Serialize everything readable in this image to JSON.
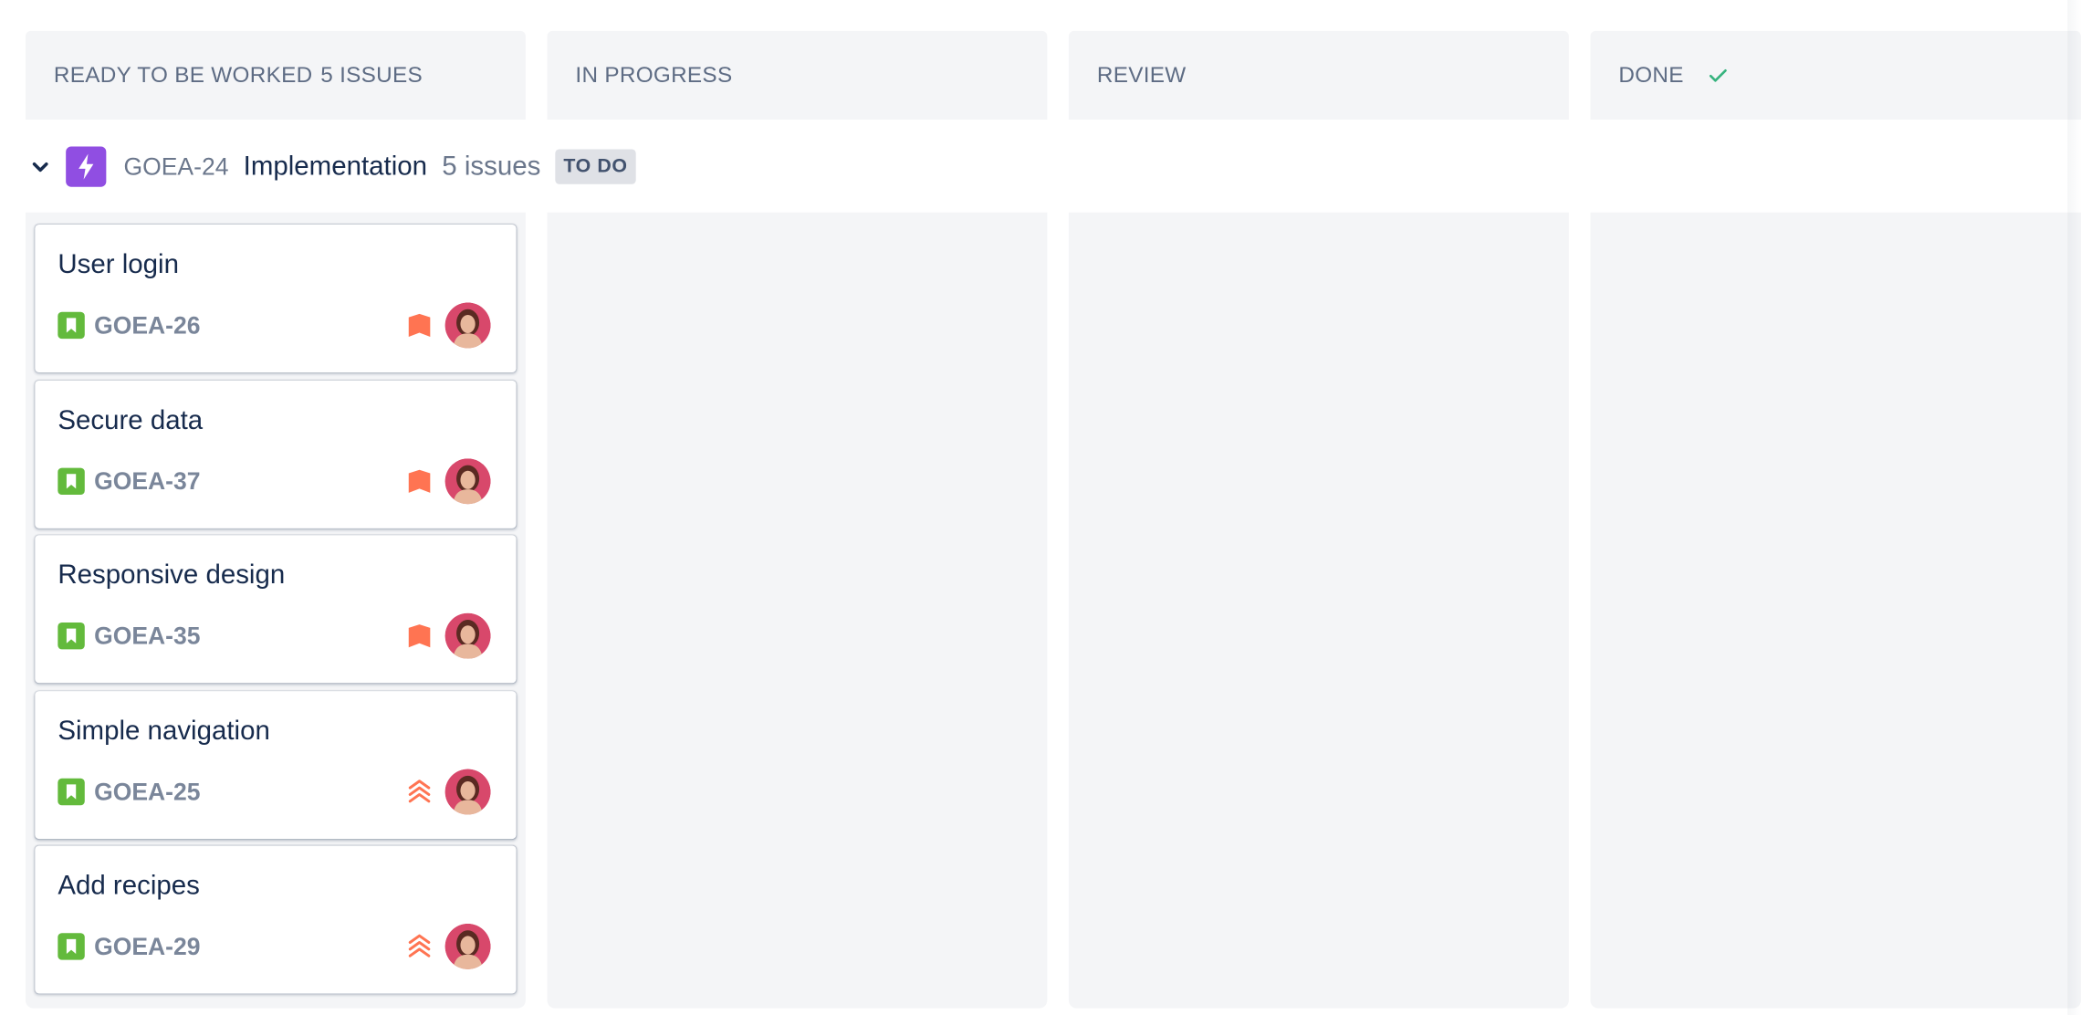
{
  "columns": [
    {
      "name": "READY TO BE WORKED",
      "count": "5 ISSUES"
    },
    {
      "name": "IN PROGRESS",
      "count": ""
    },
    {
      "name": "REVIEW",
      "count": ""
    },
    {
      "name": "DONE",
      "count": ""
    }
  ],
  "swimlane": {
    "key": "GOEA-24",
    "title": "Implementation",
    "count": "5 issues",
    "status": "TO DO"
  },
  "cards": [
    {
      "title": "User login",
      "key": "GOEA-26",
      "priority": "high"
    },
    {
      "title": "Secure data",
      "key": "GOEA-37",
      "priority": "high"
    },
    {
      "title": "Responsive design",
      "key": "GOEA-35",
      "priority": "high"
    },
    {
      "title": "Simple navigation",
      "key": "GOEA-25",
      "priority": "highest"
    },
    {
      "title": "Add recipes",
      "key": "GOEA-29",
      "priority": "highest"
    }
  ],
  "colors": {
    "epic": "#904ee2",
    "story": "#63ba3c",
    "priority": "#ff7452",
    "done_check": "#36b37e"
  },
  "icons": {
    "chevron": "chevron-down-icon",
    "epic": "lightning-icon",
    "story": "bookmark-icon",
    "priority_high": "priority-high-icon",
    "priority_highest": "priority-highest-icon",
    "done": "checkmark-icon"
  }
}
